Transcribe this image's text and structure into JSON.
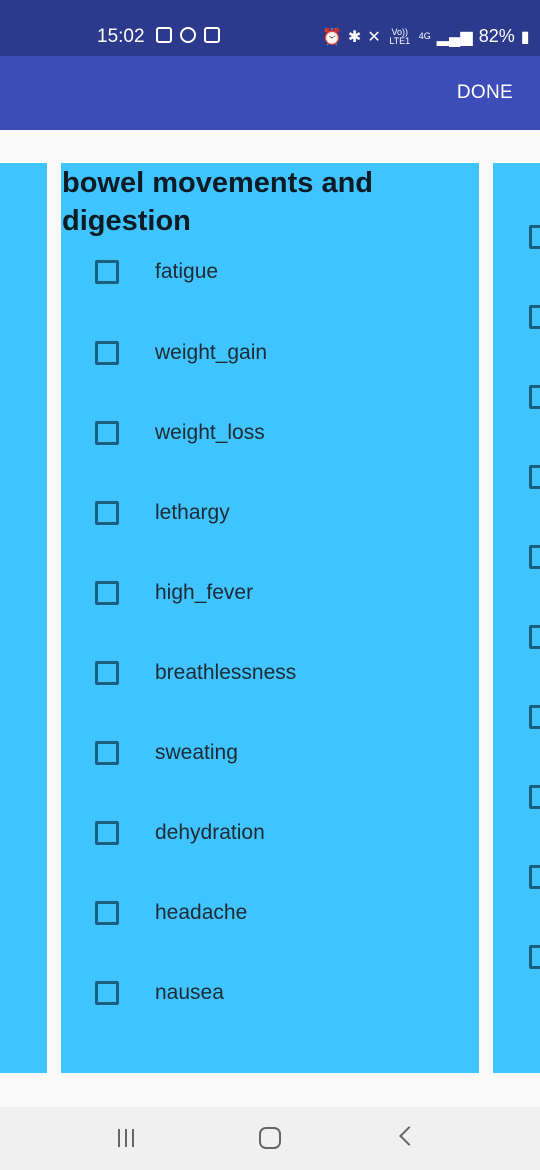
{
  "status_bar": {
    "time": "15:02",
    "left_icons": [
      "gallery-icon",
      "line-app-icon",
      "wifi-call-icon"
    ],
    "right_icons": [
      "alarm-icon",
      "bluetooth-icon",
      "mute-icon"
    ],
    "volte_label": "Vo)) LTE1",
    "network_label": "4G",
    "battery": "82%"
  },
  "app_bar": {
    "done_label": "DONE"
  },
  "panel": {
    "title": "bowel movements and digestion",
    "items": [
      {
        "label": "fatigue",
        "checked": false
      },
      {
        "label": "weight_gain",
        "checked": false
      },
      {
        "label": "weight_loss",
        "checked": false
      },
      {
        "label": "lethargy",
        "checked": false
      },
      {
        "label": "high_fever",
        "checked": false
      },
      {
        "label": "breathlessness",
        "checked": false
      },
      {
        "label": "sweating",
        "checked": false
      },
      {
        "label": "dehydration",
        "checked": false
      },
      {
        "label": "headache",
        "checked": false
      },
      {
        "label": "nausea",
        "checked": false
      }
    ]
  },
  "nav_bar": {
    "icons": [
      "recent-apps-icon",
      "home-icon",
      "back-icon"
    ]
  }
}
